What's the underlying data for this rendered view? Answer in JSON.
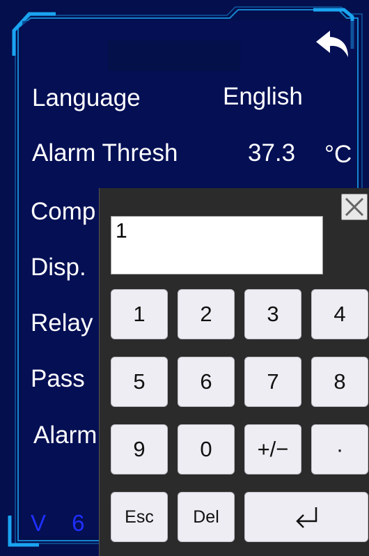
{
  "settings": {
    "rows": [
      {
        "label": "Language",
        "value": "English"
      },
      {
        "label": "Alarm Thresh",
        "value": "37.3",
        "unit": "°C"
      },
      {
        "label": "Comp"
      },
      {
        "label": "Disp."
      },
      {
        "label": "Relay"
      },
      {
        "label": "Pass"
      },
      {
        "label": "Alarm"
      }
    ],
    "version": "V 6 ."
  },
  "keypad": {
    "input_value": "1",
    "keys": [
      "1",
      "2",
      "3",
      "4",
      "5",
      "6",
      "7",
      "8",
      "9",
      "0",
      "+/−",
      "·"
    ],
    "esc_label": "Esc",
    "del_label": "Del",
    "enter_glyph": "⏎"
  },
  "colors": {
    "background": "#040f4e",
    "frame": "#1aa4f0",
    "version_text": "#1f2fff",
    "keypad_bg": "#2b2b2b",
    "key_bg": "#ededf3"
  },
  "icons": {
    "back": "back-arrow-icon",
    "close": "close-icon",
    "enter": "enter-icon"
  }
}
